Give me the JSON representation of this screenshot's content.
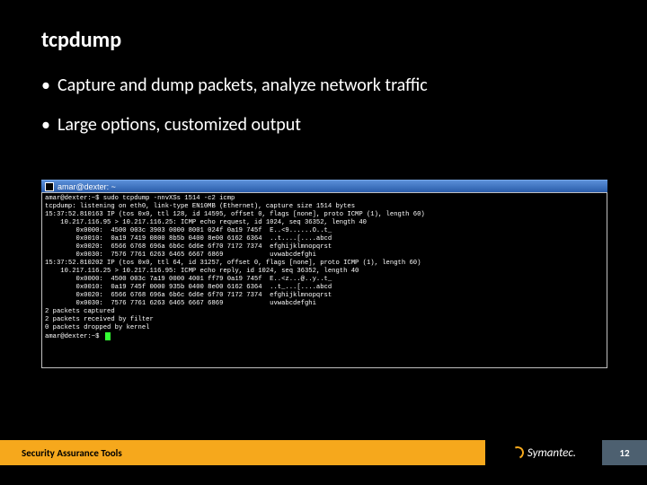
{
  "title": "tcpdump",
  "bullets": [
    "Capture and dump packets, analyze network traffic",
    "Large options, customized output"
  ],
  "terminal": {
    "title": "amar@dexter: ~",
    "lines": [
      "amar@dexter:~$ sudo tcpdump -nnvXSs 1514 -c2 icmp",
      "tcpdump: listening on eth0, link-type EN10MB (Ethernet), capture size 1514 bytes",
      "15:37:52.810163 IP (tos 0x0, ttl 128, id 14595, offset 0, flags [none], proto ICMP (1), length 60)",
      "    10.217.116.95 > 10.217.116.25: ICMP echo request, id 1024, seq 36352, length 40",
      "        0x0000:  4500 003c 3903 0000 8001 024f 0a19 745f  E..<9......O..t_",
      "        0x0010:  0a19 7419 0800 8b5b 0400 8e00 6162 6364  ..t....[....abcd",
      "        0x0020:  6566 6768 696a 6b6c 6d6e 6f70 7172 7374  efghijklmnopqrst",
      "        0x0030:  7576 7761 6263 6465 6667 6869            uvwabcdefghi",
      "15:37:52.810202 IP (tos 0x0, ttl 64, id 31257, offset 0, flags [none], proto ICMP (1), length 60)",
      "    10.217.116.25 > 10.217.116.95: ICMP echo reply, id 1024, seq 36352, length 40",
      "        0x0000:  4500 003c 7a19 0000 4001 ff79 0a19 745f  E..<z...@..y..t_",
      "        0x0010:  0a19 745f 0000 935b 0400 8e00 6162 6364  ..t_...[....abcd",
      "        0x0020:  6566 6768 696a 6b6c 6d6e 6f70 7172 7374  efghijklmnopqrst",
      "        0x0030:  7576 7761 6263 6465 6667 6869            uvwabcdefghi",
      "2 packets captured",
      "2 packets received by filter",
      "0 packets dropped by kernel",
      "amar@dexter:~$ "
    ]
  },
  "footer": {
    "left": "Security Assurance Tools",
    "brand": "Symantec.",
    "page": "12"
  }
}
